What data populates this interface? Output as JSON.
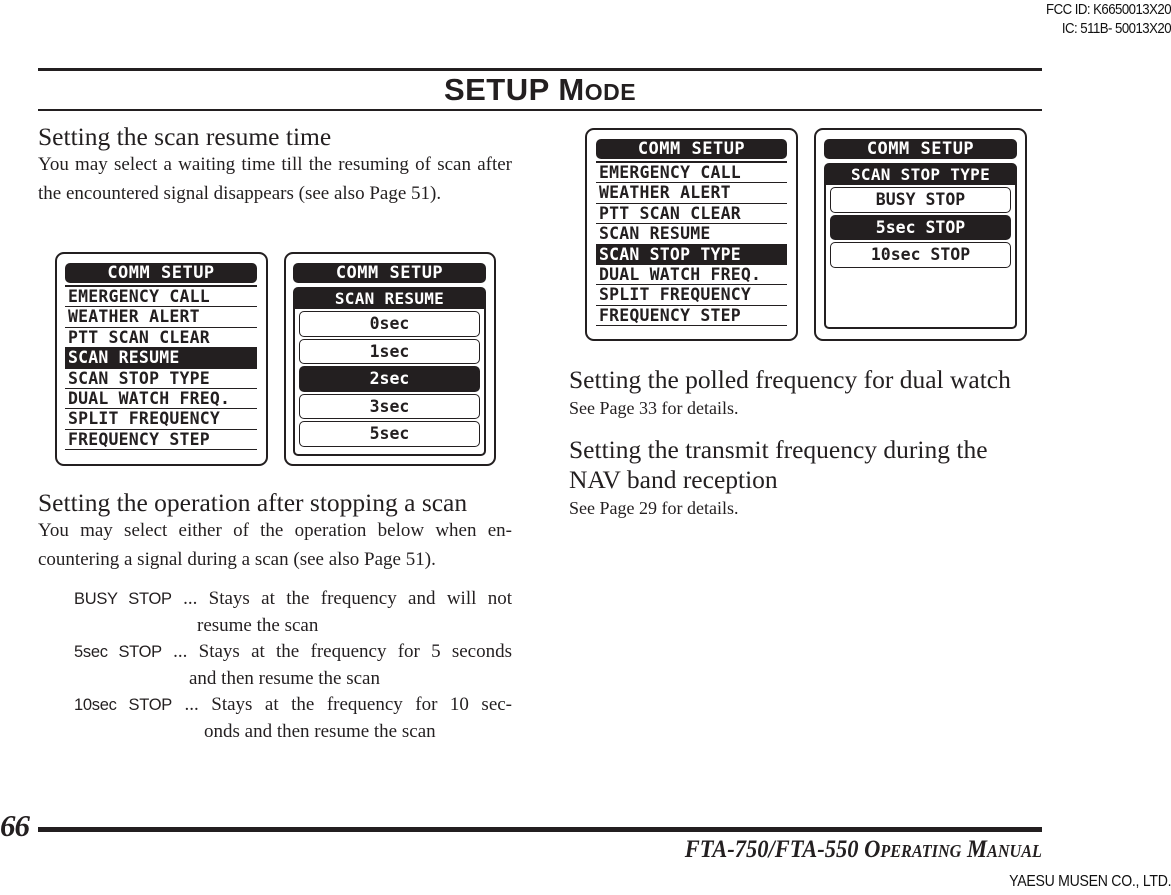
{
  "page_meta": {
    "fcc_id": "FCC ID: K6650013X20",
    "ic_id": "IC: 511B- 50013X20"
  },
  "header": {
    "title_main": "SETUP M",
    "title_smallcaps": "ODE"
  },
  "sections": {
    "scan_resume": {
      "heading": "Setting the scan resume time",
      "body": "You may select a waiting time till the resuming of scan after the encountered signal disappears (see also Page 51)."
    },
    "scan_stop": {
      "heading": "Setting the operation after stopping a scan",
      "body": "You may select either of the operation below when en-countering a signal during a scan (see also Page 51).",
      "definitions": [
        {
          "term": "BUSY STOP",
          "sep": " ... ",
          "text": "Stays at the frequency and will not",
          "cont": "resume the scan"
        },
        {
          "term": "5sec STOP",
          "sep": " ... ",
          "text": "Stays at the frequency for 5 seconds",
          "cont": "and then resume the scan"
        },
        {
          "term": "10sec STOP",
          "sep": " ... ",
          "text": "Stays at the frequency for 10 sec-",
          "cont": "onds and then resume the scan"
        }
      ]
    },
    "dual_watch": {
      "heading": "Setting the polled frequency for dual watch",
      "body": "See Page 33 for details."
    },
    "nav_band": {
      "heading_line1": "Setting the transmit frequency during the",
      "heading_line2": "NAV band reception",
      "body": "See Page 29 for details."
    }
  },
  "screens": {
    "menu_title": "COMM SETUP",
    "menu_items": [
      "EMERGENCY CALL",
      "WEATHER ALERT",
      "PTT SCAN CLEAR",
      "SCAN RESUME",
      "SCAN STOP TYPE",
      "DUAL WATCH FREQ.",
      "SPLIT FREQUENCY",
      "FREQUENCY STEP"
    ],
    "screen1_selected": "SCAN RESUME",
    "screen3_selected": "SCAN STOP TYPE",
    "scan_resume_sub": {
      "title": "SCAN RESUME",
      "options": [
        "0sec",
        "1sec",
        "2sec",
        "3sec",
        "5sec"
      ],
      "selected": "2sec"
    },
    "scan_stop_sub": {
      "title": "SCAN STOP TYPE",
      "options": [
        "BUSY STOP",
        "5sec STOP",
        "10sec STOP"
      ],
      "selected": "5sec STOP"
    }
  },
  "footer": {
    "page_number": "66",
    "manual_main1": "FTA-750/FTA-550 O",
    "manual_sc1": "PERATING",
    "manual_main2": " M",
    "manual_sc2": "ANUAL",
    "company": "YAESU MUSEN CO., LTD."
  }
}
